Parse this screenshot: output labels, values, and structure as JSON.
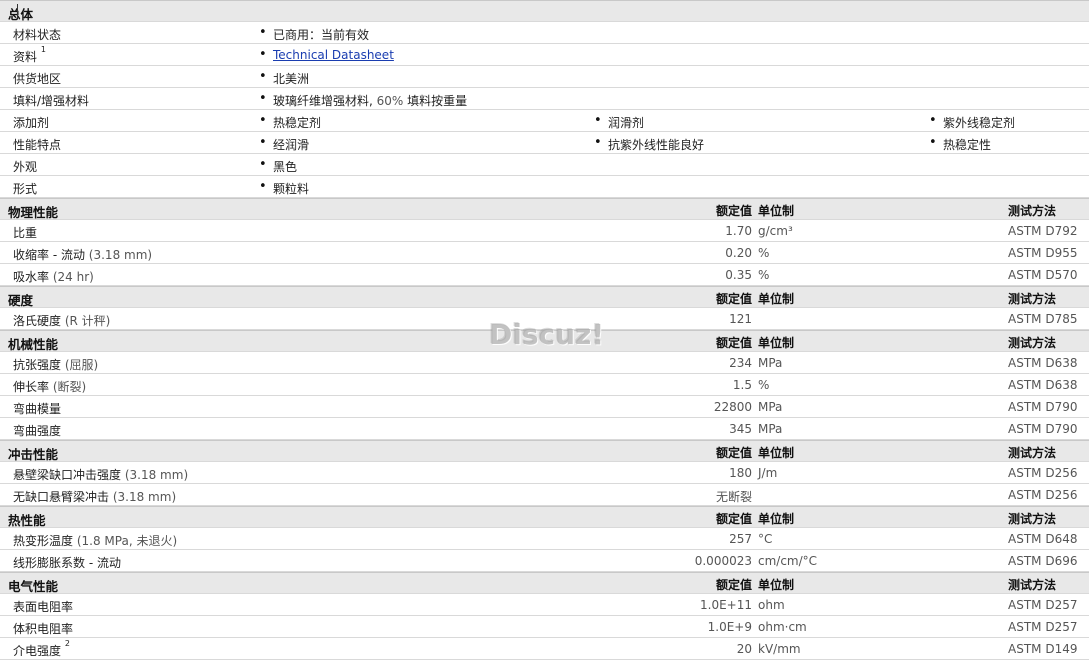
{
  "general": {
    "title": "总体",
    "rows": [
      {
        "label": "材料状态",
        "items": [
          {
            "text": "已商用：当前有效"
          }
        ]
      },
      {
        "label": "资料",
        "sup": "1",
        "items": [
          {
            "text": "Technical Datasheet",
            "link": true
          }
        ]
      },
      {
        "label": "供货地区",
        "items": [
          {
            "text": "北美洲"
          }
        ]
      },
      {
        "label": "填料/增强材料",
        "items": [
          {
            "text": "玻璃纤维增强材料,",
            "extra": " 60% ",
            "tail": "填料按重量"
          }
        ]
      },
      {
        "label": "添加剂",
        "items": [
          {
            "text": "热稳定剂"
          },
          {
            "text": "润滑剂"
          },
          {
            "text": "紫外线稳定剂"
          }
        ]
      },
      {
        "label": "性能特点",
        "items": [
          {
            "text": "经润滑"
          },
          {
            "text": "抗紫外线性能良好"
          },
          {
            "text": "热稳定性"
          }
        ]
      },
      {
        "label": "外观",
        "items": [
          {
            "text": "黑色"
          }
        ]
      },
      {
        "label": "形式",
        "items": [
          {
            "text": "颗粒料"
          }
        ]
      }
    ]
  },
  "headers": {
    "value": "额定值",
    "unit": "单位制",
    "method": "测试方法"
  },
  "sections": [
    {
      "title": "物理性能",
      "rows": [
        {
          "label": "比重",
          "cond": "",
          "value": "1.70",
          "unit": "g/cm³",
          "method": "ASTM D792"
        },
        {
          "label": "收缩率 - 流动",
          "cond": "(3.18 mm)",
          "value": "0.20",
          "unit": "%",
          "method": "ASTM D955"
        },
        {
          "label": "吸水率",
          "cond": "(24 hr)",
          "value": "0.35",
          "unit": "%",
          "method": "ASTM D570"
        }
      ]
    },
    {
      "title": "硬度",
      "rows": [
        {
          "label": "洛氏硬度",
          "cond": "(R 计秤)",
          "value": "121",
          "unit": "",
          "method": "ASTM D785"
        }
      ]
    },
    {
      "title": "机械性能",
      "rows": [
        {
          "label": "抗张强度",
          "cond": "(屈服)",
          "value": "234",
          "unit": "MPa",
          "method": "ASTM D638"
        },
        {
          "label": "伸长率",
          "cond": "(断裂)",
          "value": "1.5",
          "unit": "%",
          "method": "ASTM D638"
        },
        {
          "label": "弯曲模量",
          "cond": "",
          "value": "22800",
          "unit": "MPa",
          "method": "ASTM D790"
        },
        {
          "label": "弯曲强度",
          "cond": "",
          "value": "345",
          "unit": "MPa",
          "method": "ASTM D790"
        }
      ]
    },
    {
      "title": "冲击性能",
      "rows": [
        {
          "label": "悬壁梁缺口冲击强度",
          "cond": "(3.18 mm)",
          "value": "180",
          "unit": "J/m",
          "method": "ASTM D256"
        },
        {
          "label": "无缺口悬臂梁冲击",
          "cond": "(3.18 mm)",
          "value": "无断裂",
          "unit": "",
          "method": "ASTM D256"
        }
      ]
    },
    {
      "title": "热性能",
      "rows": [
        {
          "label": "热变形温度",
          "cond": "(1.8 MPa, 未退火)",
          "value": "257",
          "unit": "°C",
          "method": "ASTM D648"
        },
        {
          "label": "线形膨胀系数 - 流动",
          "cond": "",
          "value": "0.000023",
          "unit": "cm/cm/°C",
          "method": "ASTM D696"
        }
      ]
    },
    {
      "title": "电气性能",
      "rows": [
        {
          "label": "表面电阻率",
          "cond": "",
          "value": "1.0E+11",
          "unit": "ohm",
          "method": "ASTM D257"
        },
        {
          "label": "体积电阻率",
          "cond": "",
          "value": "1.0E+9",
          "unit": "ohm·cm",
          "method": "ASTM D257"
        },
        {
          "label": "介电强度",
          "sup": "2",
          "cond": "",
          "value": "20",
          "unit": "kV/mm",
          "method": "ASTM D149"
        }
      ]
    }
  ],
  "watermark": "Discuz!"
}
